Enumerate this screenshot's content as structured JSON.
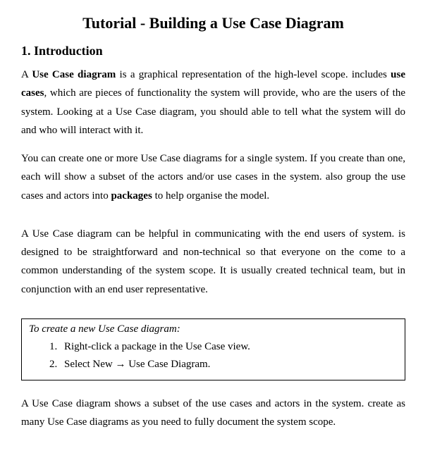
{
  "title": "Tutorial - Building a Use Case Diagram",
  "section1": {
    "heading": "1. Introduction",
    "para1_prefix": "A ",
    "para1_bold1": "Use Case diagram",
    "para1_mid1": " is a graphical representation of the high-level scope. includes ",
    "para1_bold2": "use cases",
    "para1_suffix": ", which are pieces of functionality the system will provide, who are the users of the system. Looking at a Use Case diagram, you should able to tell what the system will do and who will interact with it.",
    "para2_prefix": "You can create one or more Use Case diagrams for a single system. If you create than one, each will show a subset of the actors and/or use cases in the system. also group the use cases and actors into ",
    "para2_bold": "packages",
    "para2_suffix": " to help organise the model.",
    "para3": "A Use Case diagram can be helpful in communicating with the end users of system. is designed to be straightforward and non-technical so that everyone on the come to a common understanding of the system scope. It is usually created technical team, but in conjunction with an end user representative.",
    "callout": {
      "title": "To create a new Use Case diagram:",
      "items": [
        "Right-click a package in the Use Case view.",
        "Select New → Use Case Diagram."
      ]
    },
    "para4": "A Use Case diagram shows a subset of the use cases and actors in the system. create as many Use Case diagrams as you need to fully document the system scope."
  }
}
